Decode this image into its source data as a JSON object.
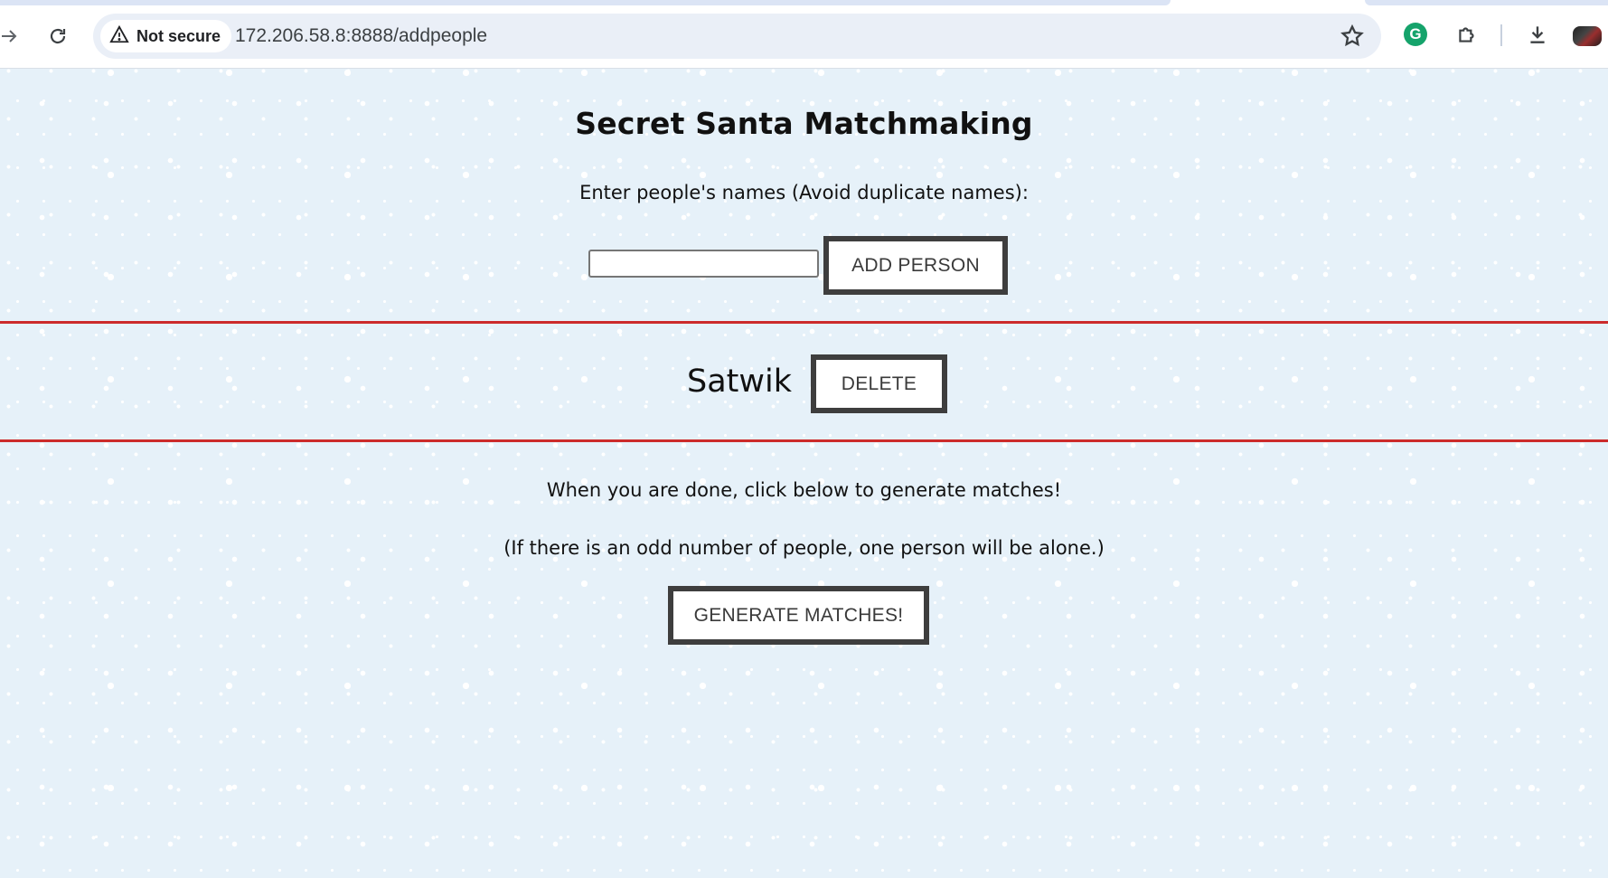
{
  "browser": {
    "security_label": "Not secure",
    "url": "172.206.58.8:8888/addpeople",
    "grammarly_letter": "G"
  },
  "icons": {
    "back": "back-arrow-icon",
    "reload": "reload-icon",
    "warning": "warning-triangle-icon",
    "bookmark": "star-icon",
    "grammarly": "grammarly-icon",
    "extensions": "puzzle-piece-icon",
    "downloads": "download-icon",
    "profile": "avatar"
  },
  "colors": {
    "page_background": "#e6f1f9",
    "divider": "#cc2b2b",
    "button_border": "#3e3e3e"
  },
  "page": {
    "title": "Secret Santa Matchmaking",
    "instruction": "Enter people's names (Avoid duplicate names):",
    "name_input_value": "",
    "add_button_label": "ADD PERSON",
    "people": [
      {
        "name": "Satwik",
        "delete_label": "DELETE"
      }
    ],
    "done_text": "When you are done, click below to generate matches!",
    "odd_text": "(If there is an odd number of people, one person will be alone.)",
    "generate_button_label": "GENERATE MATCHES!"
  }
}
